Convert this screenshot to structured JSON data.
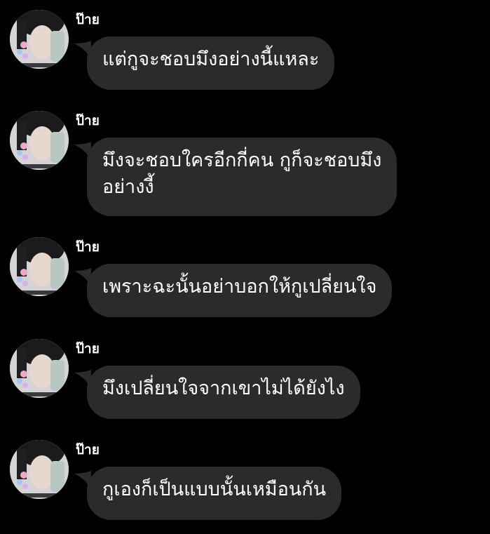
{
  "chat": {
    "messages": [
      {
        "sender": "ป๊าย",
        "avatar_icon": "profile-photo-avatar",
        "text": "แต่กูจะชอบมึงอย่างนี้แหละ"
      },
      {
        "sender": "ป๊าย",
        "avatar_icon": "profile-photo-avatar",
        "text": "มึงจะชอบใครอีกกี่คน กูก็จะชอบมึง\nอย่างงี้"
      },
      {
        "sender": "ป๊าย",
        "avatar_icon": "profile-photo-avatar",
        "text": "เพราะฉะนั้นอย่าบอกให้กูเปลี่ยนใจ"
      },
      {
        "sender": "ป๊าย",
        "avatar_icon": "profile-photo-avatar",
        "text": "มึงเปลี่ยนใจจากเขาไม่ได้ยังไง"
      },
      {
        "sender": "ป๊าย",
        "avatar_icon": "profile-photo-avatar",
        "text": "กูเองก็เป็นแบบนั้นเหมือนกัน"
      }
    ]
  },
  "colors": {
    "background": "#000000",
    "bubble": "#2b2b2d",
    "text": "#ffffff"
  }
}
